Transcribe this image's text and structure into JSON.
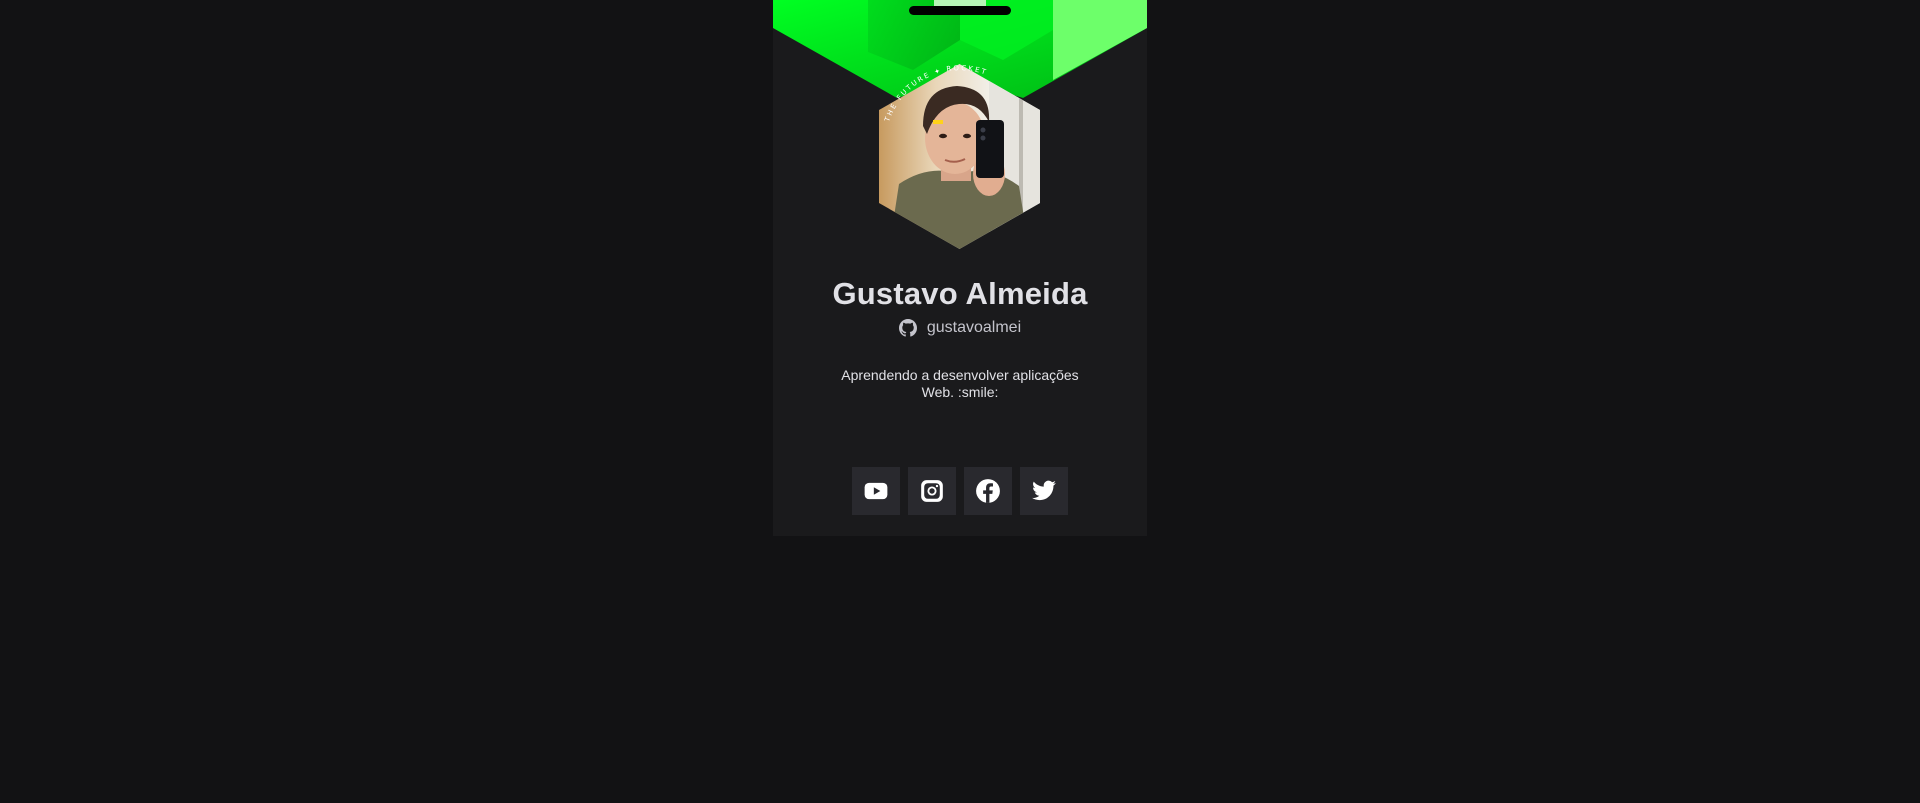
{
  "profile": {
    "name": "Gustavo Almeida",
    "github_username": "gustavoalmei",
    "bio_line1": "Aprendendo a desenvolver aplicações",
    "bio_line2": "Web. :smile:",
    "avatar_ring_text": "THE FUTURE ✦ ROCKET"
  },
  "socials": [
    {
      "name": "YouTube",
      "icon": "youtube-icon"
    },
    {
      "name": "Instagram",
      "icon": "instagram-icon"
    },
    {
      "name": "Facebook",
      "icon": "facebook-icon"
    },
    {
      "name": "Twitter",
      "icon": "twitter-icon"
    }
  ],
  "colors": {
    "background": "#121214",
    "card": "#1a1a1c",
    "accent_green": "#00e01a",
    "accent_light_green": "#6dff6a",
    "social_bg": "#29292e",
    "text_primary": "#e1e1e6",
    "text_secondary": "#c4c4cc"
  }
}
